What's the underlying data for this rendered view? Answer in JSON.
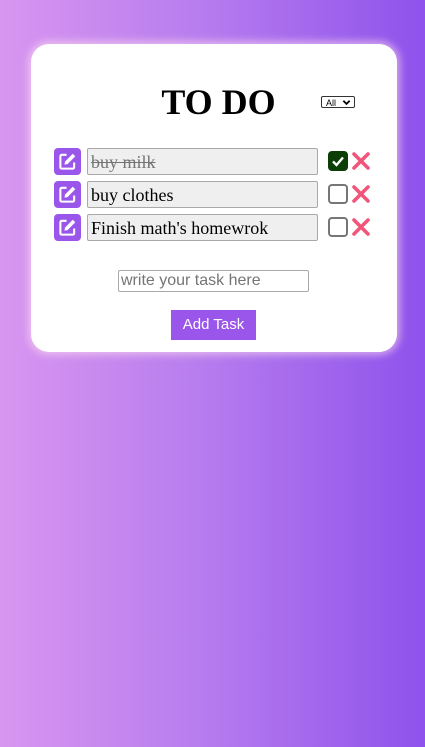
{
  "app": {
    "title": "TO DO"
  },
  "filter": {
    "selected": "All"
  },
  "tasks": [
    {
      "text": "buy milk",
      "done": true
    },
    {
      "text": "buy clothes",
      "done": false
    },
    {
      "text": "Finish math's homewrok",
      "done": false
    }
  ],
  "new_task": {
    "value": "",
    "placeholder": "write your task here"
  },
  "add_button": {
    "label": "Add Task"
  },
  "colors": {
    "accent": "#9a56ea",
    "checked": "#0b3f06",
    "delete": "#f0567a"
  },
  "icons": {
    "edit": "edit-icon",
    "delete": "close-icon",
    "check": "checkmark-icon",
    "dropdown": "chevron-down-icon"
  }
}
